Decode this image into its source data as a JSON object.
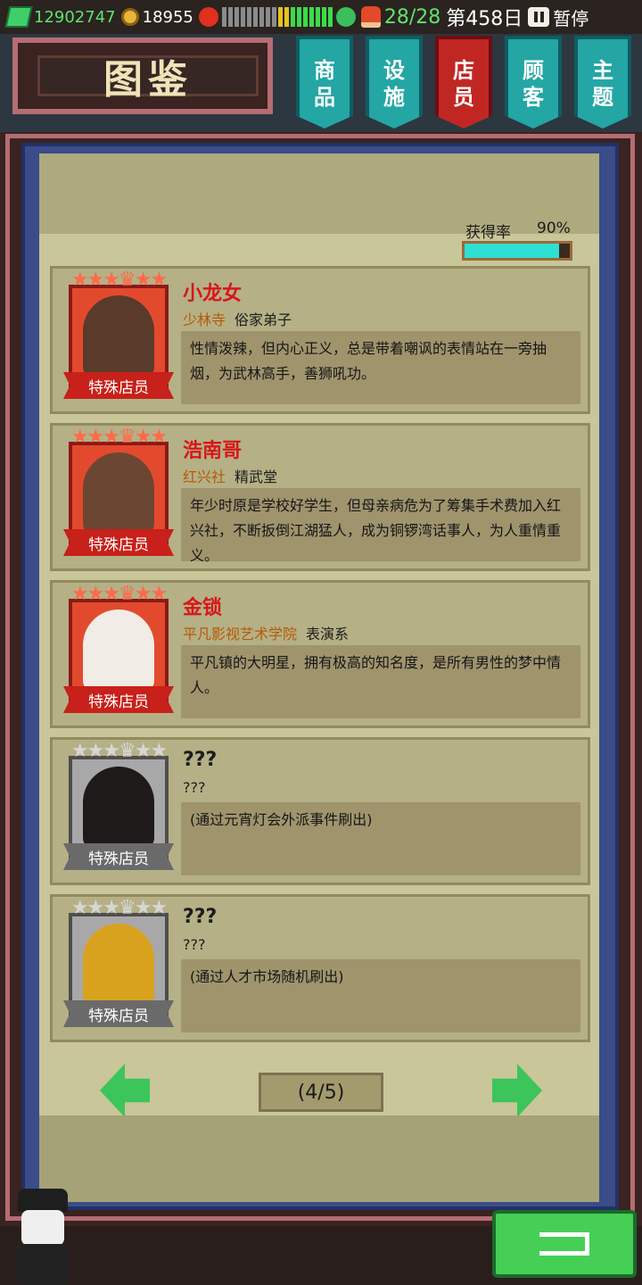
{
  "status": {
    "money": "12902747",
    "coins": "18955",
    "mood_total_segments": 18,
    "mood_level": 0.5,
    "staff_count": "28/28",
    "day": "第458日",
    "pause_label": "暂停"
  },
  "header": {
    "title": "图鉴",
    "tabs": [
      {
        "label": "商品",
        "active": false
      },
      {
        "label": "设施",
        "active": false
      },
      {
        "label": "店员",
        "active": true
      },
      {
        "label": "顾客",
        "active": false
      },
      {
        "label": "主题",
        "active": false
      }
    ]
  },
  "rate": {
    "label": "获得率",
    "value": "90%",
    "fraction": 0.9
  },
  "staff": [
    {
      "name": "小龙女",
      "org1": "少林寺",
      "org2": "俗家弟子",
      "desc": "性情泼辣，但内心正义，总是带着嘲讽的表情站在一旁抽烟，为武林高手，善狮吼功。",
      "badge": "特殊店员",
      "locked": false,
      "stars": "★★★♛★★"
    },
    {
      "name": "浩南哥",
      "org1": "红兴社",
      "org2": "精武堂",
      "desc": "年少时原是学校好学生，但母亲病危为了筹集手术费加入红兴社，不断扳倒江湖猛人，成为铜锣湾话事人，为人重情重义。",
      "badge": "特殊店员",
      "locked": false,
      "stars": "★★★♛★★"
    },
    {
      "name": "金锁",
      "org1": "平凡影视艺术学院",
      "org2": "表演系",
      "desc": "平凡镇的大明星，拥有极高的知名度，是所有男性的梦中情人。",
      "badge": "特殊店员",
      "locked": false,
      "stars": "★★★♛★★"
    },
    {
      "name": "???",
      "org1": "???",
      "org2": "",
      "desc": "(通过元宵灯会外派事件刷出)",
      "badge": "特殊店员",
      "locked": true,
      "stars": "★★★♛★★"
    },
    {
      "name": "???",
      "org1": "???",
      "org2": "",
      "desc": "(通过人才市场随机刷出)",
      "badge": "特殊店员",
      "locked": true,
      "stars": "★★★♛★★"
    }
  ],
  "pager": {
    "page": "(4/5)"
  },
  "colors": {
    "accent_teal": "#23a6a4",
    "accent_red": "#c02723",
    "name_red": "#d8161a",
    "org_orange": "#b55a06",
    "rate_fill": "#2de0d3",
    "button_green": "#45cf55"
  },
  "icons": [
    "money-icon",
    "coin-icon",
    "angry-face-icon",
    "happy-face-icon",
    "staff-icon",
    "pause-icon",
    "arrow-left-icon",
    "arrow-right-icon",
    "back-icon"
  ]
}
